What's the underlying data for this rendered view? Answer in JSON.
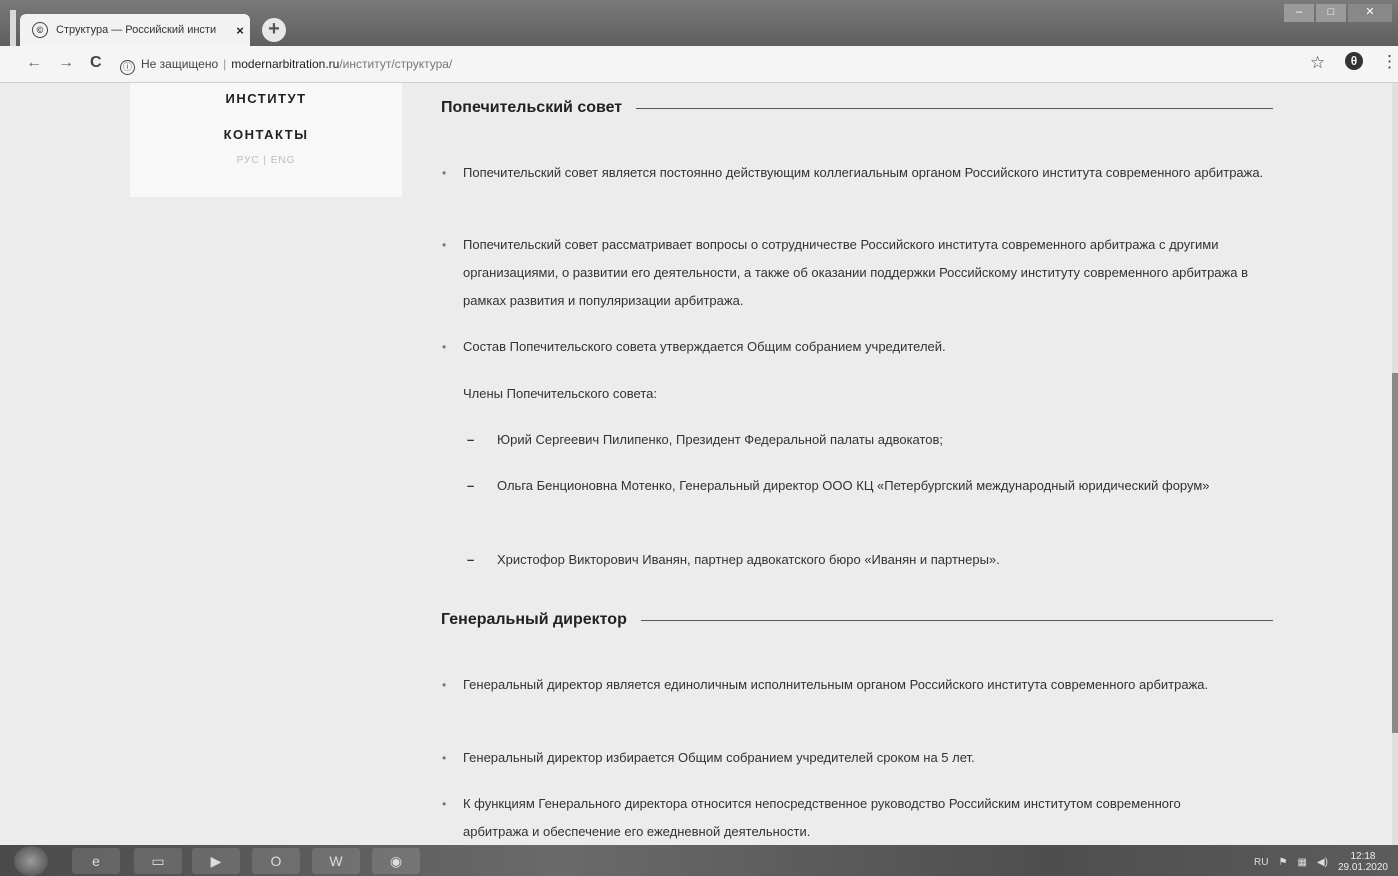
{
  "browser": {
    "tab_title": "Структура — Российский инсти",
    "tab_close": "×",
    "new_tab": "+",
    "nav_back": "←",
    "nav_forward": "→",
    "nav_reload": "C",
    "security_icon": "ⓘ",
    "security_label": "Не защищено",
    "url_separator": "|",
    "url_host": "modernarbitration.ru",
    "url_path": "/институт/структура/",
    "bookmark": "☆",
    "menu": "⋮"
  },
  "sidebar": {
    "items": [
      {
        "label": "ИНСТИТУТ"
      },
      {
        "label": "КОНТАКТЫ"
      }
    ],
    "language_switch": "РУС | ENG"
  },
  "sections": [
    {
      "title": "Попечительский совет",
      "bullets": [
        "Попечительский совет является постоянно действующим коллегиальным органом Российского института современного арбитража.",
        "Попечительский совет рассматривает вопросы о сотрудничестве Российского института современного арбитража с другими организациями, о развитии его деятельности, а также об оказании поддержки Российскому институту современного арбитража в рамках развития и популяризации арбитража.",
        "Состав Попечительского совета утверждается Общим собранием учредителей."
      ],
      "members_title": "Члены Попечительского совета:",
      "members": [
        "Юрий Сергеевич Пилипенко, Президент Федеральной палаты адвокатов;",
        "Ольга Бенционовна Мотенко, Генеральный директор ООО КЦ «Петербургский международный юридический форум»",
        "Христофор Викторович Иванян, партнер адвокатского бюро «Иванян и партнеры»."
      ]
    },
    {
      "title": "Генеральный директор",
      "bullets": [
        "Генеральный директор является единоличным исполнительным органом Российского института современного арбитража.",
        "Генеральный директор избирается Общим собранием учредителей сроком на 5 лет.",
        "К функциям Генерального директора относится непосредственное руководство Российским институтом современного арбитража и обеспечение его ежедневной деятельности."
      ]
    }
  ],
  "taskbar": {
    "tray_lang": "RU",
    "time": "12:18",
    "date": "29.01.2020"
  }
}
